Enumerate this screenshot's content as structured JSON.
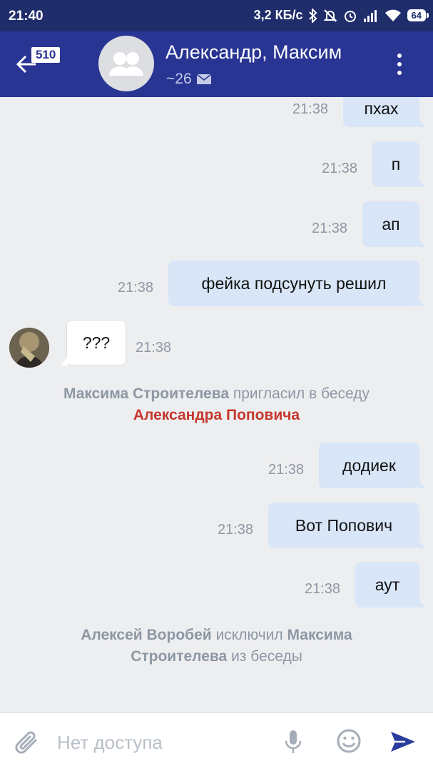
{
  "status_bar": {
    "time": "21:40",
    "speed": "3,2 КБ/с",
    "battery": "64"
  },
  "header": {
    "unread_badge": "510",
    "title": "Александр, Максим",
    "subtitle": "~26"
  },
  "messages": [
    {
      "text": "пхах",
      "time": "21:38"
    },
    {
      "text": "п",
      "time": "21:38"
    },
    {
      "text": "ап",
      "time": "21:38"
    },
    {
      "text": "фейка подсунуть решил",
      "time": "21:38"
    },
    {
      "text": "???",
      "time": "21:38"
    },
    {
      "text": "додиек",
      "time": "21:38"
    },
    {
      "text": "Вот Попович",
      "time": "21:38"
    },
    {
      "text": "аут",
      "time": "21:38"
    }
  ],
  "service1": {
    "actor": "Максима Строителева",
    "action": "пригласил в беседу",
    "target": "Александра Поповича"
  },
  "service2": {
    "actor": "Алексей Воробей",
    "action": "исключил",
    "target_first": "Максима",
    "target_last": "Строителева",
    "suffix": "из беседы"
  },
  "input": {
    "placeholder": "Нет доступа"
  },
  "colors": {
    "status_bar": "#1f2d6b",
    "app_bar": "#283593",
    "outgoing_bubble": "#d8e6f7",
    "background": "#edeef0",
    "highlight_name": "#c6372c",
    "send_icon": "#2a3d9c"
  },
  "icons": [
    "bluetooth-icon",
    "mute-icon",
    "alarm-icon",
    "signal-icon",
    "wifi-icon",
    "back-arrow-icon",
    "mail-icon",
    "more-vert-icon",
    "attach-icon",
    "mic-icon",
    "emoji-icon",
    "send-icon"
  ]
}
